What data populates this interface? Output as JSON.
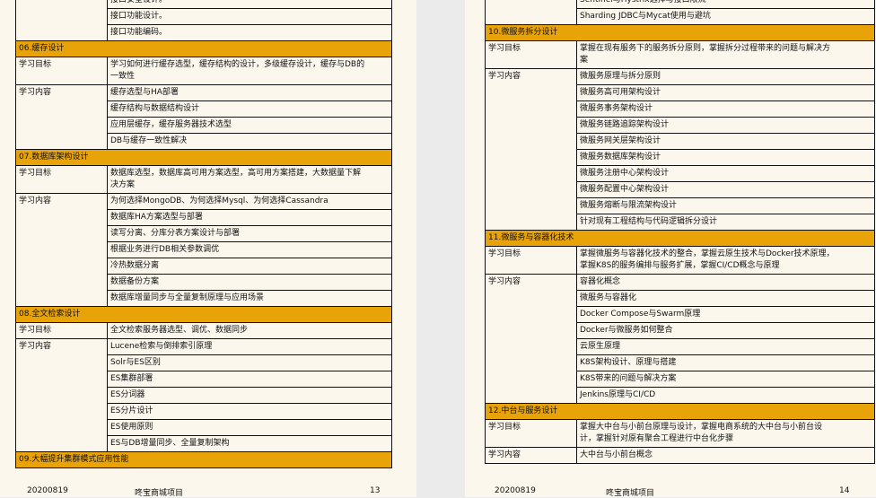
{
  "left": {
    "top_rows": [
      "接口安全设计。",
      "接口功能设计。",
      "接口功能编码。"
    ],
    "sections": [
      {
        "title": "06.缓存设计",
        "goal": [
          "学习如何进行缓存选型，缓存结构的设计，多级缓存设计，缓存与DB的",
          "一致性"
        ],
        "content": [
          "缓存选型与HA部署",
          "缓存结构与数据结构设计",
          "应用层缓存，缓存服务器技术选型",
          "DB与缓存一致性解决"
        ]
      },
      {
        "title": "07.数据库架构设计",
        "goal": [
          "数据库选型，数据库高可用方案选型，高可用方案搭建，大数据量下解",
          "决方案"
        ],
        "content": [
          "为何选择MongoDB、为何选择Mysql、为何选择Cassandra",
          "数据库HA方案选型与部署",
          "读写分离、分库分表方案设计与部署",
          "根据业务进行DB相关参数调优",
          "冷热数据分离",
          "数据备份方案",
          "数据库增量同步与全量复制原理与应用场景"
        ]
      },
      {
        "title": "08.全文检索设计",
        "goal": [
          "全文检索服务器选型、调优、数据同步"
        ],
        "content": [
          "Lucene检索与倒排索引原理",
          "Solr与ES区别",
          "ES集群部署",
          "ES分词器",
          "ES分片设计",
          "ES使用原则",
          "ES与DB增量同步、全量复制架构"
        ]
      }
    ],
    "last_title": "09.大幅提升集群模式应用性能",
    "footer": {
      "date": "20200819",
      "project": "咚宝商城项目",
      "page": "13"
    }
  },
  "right": {
    "top_rows": [
      "Sentinel与Hystrix选择与接口限流",
      "Sharding JDBC与Mycat使用与避坑"
    ],
    "sections": [
      {
        "title": "10.微服务拆分设计",
        "goal": [
          "掌握在现有服务下的服务拆分原则，掌握拆分过程带来的问题与解决方",
          "案"
        ],
        "content": [
          "微服务原理与拆分原则",
          "微服务高可用架构设计",
          "微服务事务架构设计",
          "微服务链路追踪架构设计",
          "微服务网关层架构设计",
          "微服务数据库架构设计",
          "微服务注册中心架构设计",
          "微服务配置中心架构设计",
          "微服务熔断与限流架构设计",
          "针对现有工程结构与代码逻辑拆分设计"
        ]
      },
      {
        "title": "11.微服务与容器化技术",
        "goal": [
          "掌握微服务与容器化技术的整合，掌握云原生技术与Docker技术原理，",
          "掌握K8S的服务编排与服务扩展，掌握CI/CD概念与原理"
        ],
        "content": [
          "容器化概念",
          "微服务与容器化",
          "Docker Compose与Swarm原理",
          "Docker与微服务如何整合",
          "云原生原理",
          "K8S架构设计、原理与搭建",
          "K8S带来的问题与解决方案",
          "Jenkins原理与CI/CD"
        ]
      },
      {
        "title": "12.中台与服务设计",
        "goal": [
          "掌握大中台与小前台原理与设计，掌握电商系统的大中台与小前台设",
          "计，掌握针对原有聚合工程进行中台化步骤"
        ],
        "content": [
          "大中台与小前台概念"
        ]
      }
    ],
    "footer": {
      "date": "20200819",
      "project": "咚宝商城项目",
      "page": "14"
    }
  },
  "labels": {
    "goal": "学习目标",
    "content": "学习内容"
  },
  "colors": {
    "section_bg": "#e8a308",
    "page_bg": "#fbf7ed"
  }
}
